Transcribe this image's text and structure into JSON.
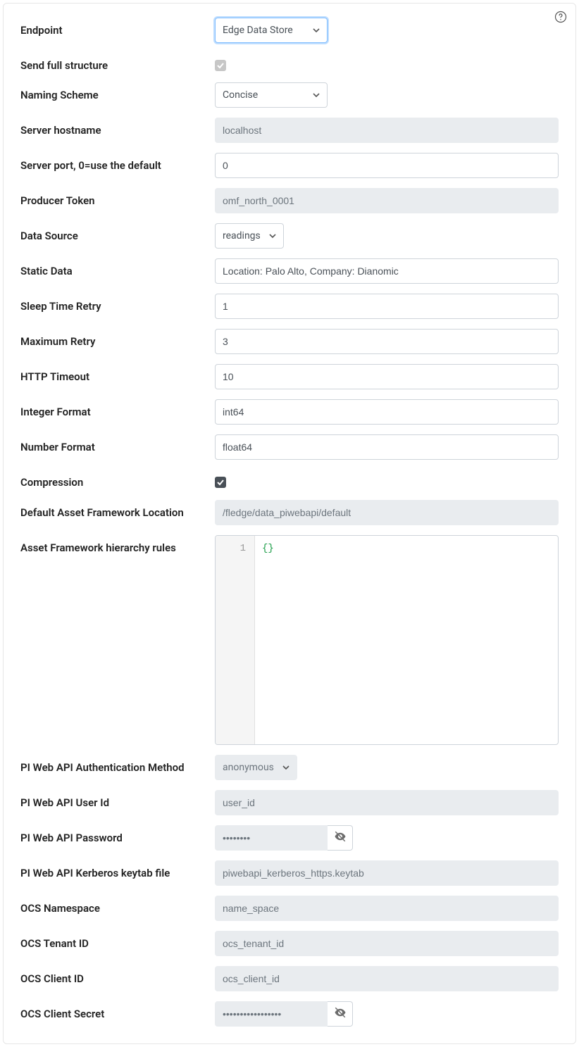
{
  "help_icon": "help",
  "fields": {
    "endpoint": {
      "label": "Endpoint",
      "value": "Edge Data Store"
    },
    "send_full_structure": {
      "label": "Send full structure",
      "checked": true,
      "disabled": true
    },
    "naming_scheme": {
      "label": "Naming Scheme",
      "value": "Concise"
    },
    "server_hostname": {
      "label": "Server hostname",
      "value": "localhost",
      "disabled": true
    },
    "server_port": {
      "label": "Server port, 0=use the default",
      "value": "0"
    },
    "producer_token": {
      "label": "Producer Token",
      "value": "omf_north_0001",
      "disabled": true
    },
    "data_source": {
      "label": "Data Source",
      "value": "readings"
    },
    "static_data": {
      "label": "Static Data",
      "value": "Location: Palo Alto, Company: Dianomic"
    },
    "sleep_time_retry": {
      "label": "Sleep Time Retry",
      "value": "1"
    },
    "maximum_retry": {
      "label": "Maximum Retry",
      "value": "3"
    },
    "http_timeout": {
      "label": "HTTP Timeout",
      "value": "10"
    },
    "integer_format": {
      "label": "Integer Format",
      "value": "int64"
    },
    "number_format": {
      "label": "Number Format",
      "value": "float64"
    },
    "compression": {
      "label": "Compression",
      "checked": true,
      "disabled": false
    },
    "default_af_location": {
      "label": "Default Asset Framework Location",
      "value": "/fledge/data_piwebapi/default",
      "disabled": true
    },
    "af_hierarchy_rules": {
      "label": "Asset Framework hierarchy rules",
      "line_no": "1",
      "content": "{}"
    },
    "piwebapi_auth_method": {
      "label": "PI Web API Authentication Method",
      "value": "anonymous",
      "disabled": true
    },
    "piwebapi_user_id": {
      "label": "PI Web API User Id",
      "value": "user_id",
      "disabled": true
    },
    "piwebapi_password": {
      "label": "PI Web API Password",
      "value": "••••••••",
      "disabled": true
    },
    "piwebapi_keytab": {
      "label": "PI Web API Kerberos keytab file",
      "value": "piwebapi_kerberos_https.keytab",
      "disabled": true
    },
    "ocs_namespace": {
      "label": "OCS Namespace",
      "value": "name_space",
      "disabled": true
    },
    "ocs_tenant_id": {
      "label": "OCS Tenant ID",
      "value": "ocs_tenant_id",
      "disabled": true
    },
    "ocs_client_id": {
      "label": "OCS Client ID",
      "value": "ocs_client_id",
      "disabled": true
    },
    "ocs_client_secret": {
      "label": "OCS Client Secret",
      "value": "•••••••••••••••••",
      "disabled": true
    }
  }
}
